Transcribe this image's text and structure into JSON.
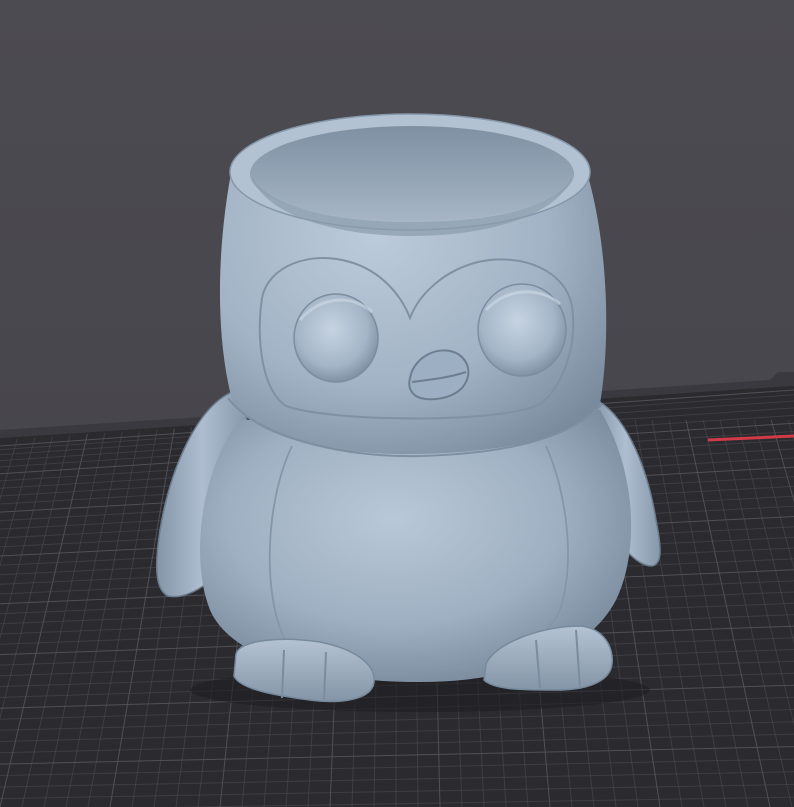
{
  "viewport": {
    "background_color": "#4a494f",
    "bed_color": "#2b2a2f",
    "grid_color": "#55545b",
    "axis_color": "#d13a47",
    "model_color": "#9fb0c2"
  },
  "model": {
    "name": "penguin-planter",
    "features": [
      "pot-opening",
      "left-eye",
      "right-eye",
      "beak",
      "left-wing",
      "right-wing",
      "belly",
      "left-foot",
      "right-foot"
    ]
  }
}
